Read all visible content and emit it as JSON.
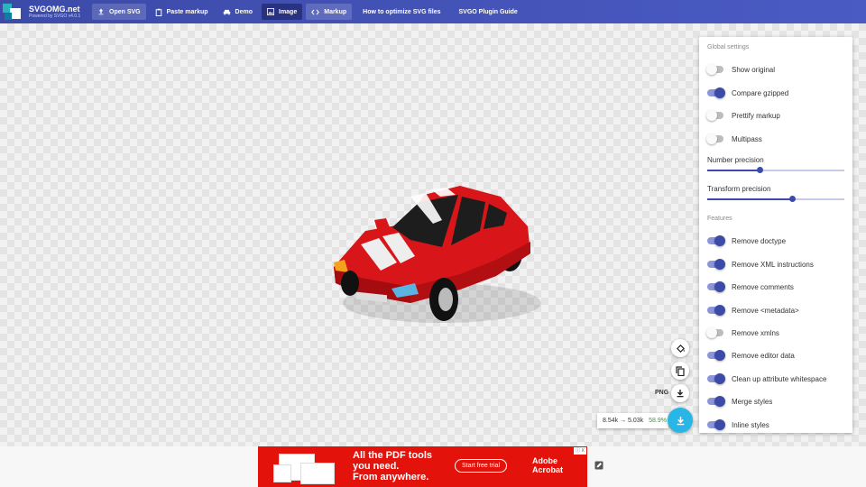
{
  "header": {
    "brand_title": "SVGOMG.net",
    "brand_subtitle": "Powered by SVGO v4.0.1",
    "buttons": {
      "open_svg": "Open SVG",
      "paste_markup": "Paste markup",
      "demo": "Demo",
      "image": "Image",
      "markup": "Markup",
      "optimize_link": "How to optimize SVG files",
      "plugin_guide": "SVGO Plugin Guide"
    }
  },
  "settings": {
    "global_title": "Global settings",
    "global_toggles": [
      {
        "label": "Show original",
        "on": false
      },
      {
        "label": "Compare gzipped",
        "on": true
      },
      {
        "label": "Prettify markup",
        "on": false
      },
      {
        "label": "Multipass",
        "on": false
      }
    ],
    "number_precision": {
      "label": "Number precision",
      "fraction": 0.38
    },
    "transform_precision": {
      "label": "Transform precision",
      "fraction": 0.62
    },
    "features_title": "Features",
    "feature_toggles": [
      {
        "label": "Remove doctype",
        "on": true
      },
      {
        "label": "Remove XML instructions",
        "on": true
      },
      {
        "label": "Remove comments",
        "on": true
      },
      {
        "label": "Remove <metadata>",
        "on": true
      },
      {
        "label": "Remove xmlns",
        "on": false
      },
      {
        "label": "Remove editor data",
        "on": true
      },
      {
        "label": "Clean up attribute whitespace",
        "on": true
      },
      {
        "label": "Merge styles",
        "on": true
      },
      {
        "label": "Inline styles",
        "on": true
      }
    ]
  },
  "output": {
    "png_label": "PNG",
    "size_text": "8.54k → 5.03k",
    "percent": "58.9%"
  },
  "ad": {
    "headline_1": "All the PDF tools",
    "headline_2": "you need.",
    "headline_3": "From anywhere.",
    "cta": "Start free trial",
    "brand_1": "Adobe",
    "brand_2": "Acrobat",
    "choice": "ⓘ X"
  },
  "colors": {
    "header": "#3c4aa8",
    "toggle_on": "#3c4aa8",
    "fab_download": "#29b6e6",
    "ad_red": "#e3120b",
    "savings_green": "#3a9a3a"
  }
}
